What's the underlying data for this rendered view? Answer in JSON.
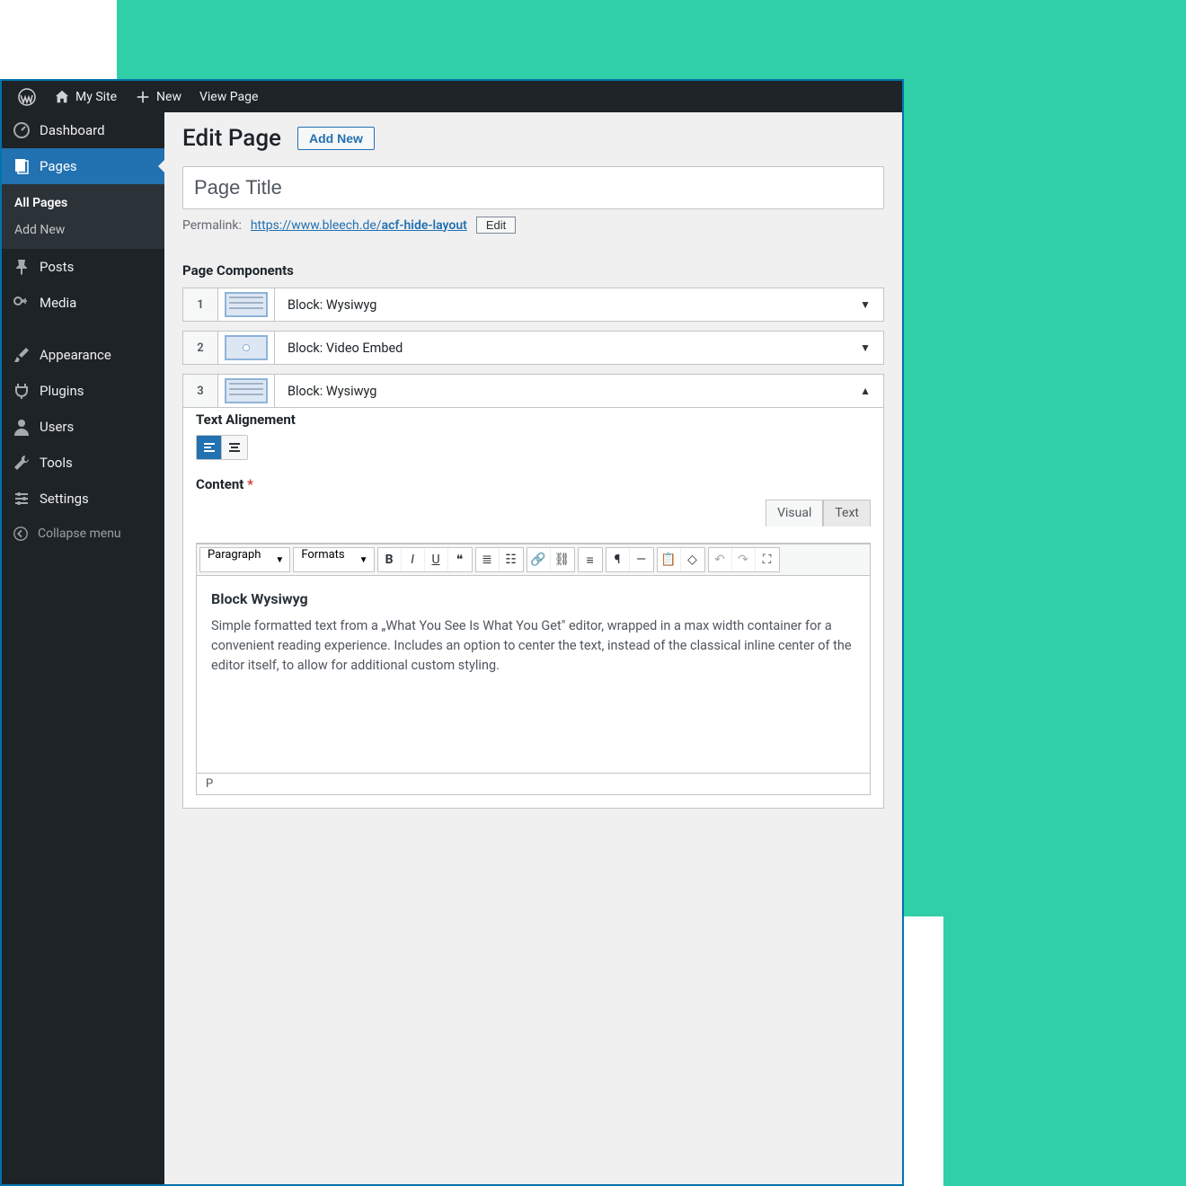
{
  "topbar": {
    "site_name": "My Site",
    "new_label": "New",
    "view_page": "View Page"
  },
  "sidebar": {
    "dashboard": "Dashboard",
    "pages": "Pages",
    "all_pages": "All Pages",
    "add_new": "Add New",
    "posts": "Posts",
    "media": "Media",
    "appearance": "Appearance",
    "plugins": "Plugins",
    "users": "Users",
    "tools": "Tools",
    "settings": "Settings",
    "collapse": "Collapse menu"
  },
  "header": {
    "title": "Edit Page",
    "add_new": "Add New"
  },
  "title_field": {
    "value": "Page Title"
  },
  "permalink": {
    "label": "Permalink:",
    "base": "https://www.bleech.de/",
    "slug": "acf-hide-layout",
    "edit": "Edit"
  },
  "components": {
    "heading": "Page Components",
    "blocks": [
      {
        "num": "1",
        "label": "Block: Wysiwyg",
        "open": false
      },
      {
        "num": "2",
        "label": "Block: Video Embed",
        "open": false
      },
      {
        "num": "3",
        "label": "Block: Wysiwyg",
        "open": true
      }
    ]
  },
  "panel": {
    "alignment_label": "Text Alignement",
    "content_label": "Content"
  },
  "editor": {
    "visual": "Visual",
    "text_tab": "Text",
    "paragraph": "Paragraph",
    "formats": "Formats",
    "heading": "Block Wysiwyg",
    "body": "Simple formatted text from a „What You See Is What You Get\" editor, wrapped in a max width container for a convenient reading experience. Includes an option to center the text, instead of the classical inline center of the editor itself, to allow for additional custom styling.",
    "footer_path": "P"
  }
}
